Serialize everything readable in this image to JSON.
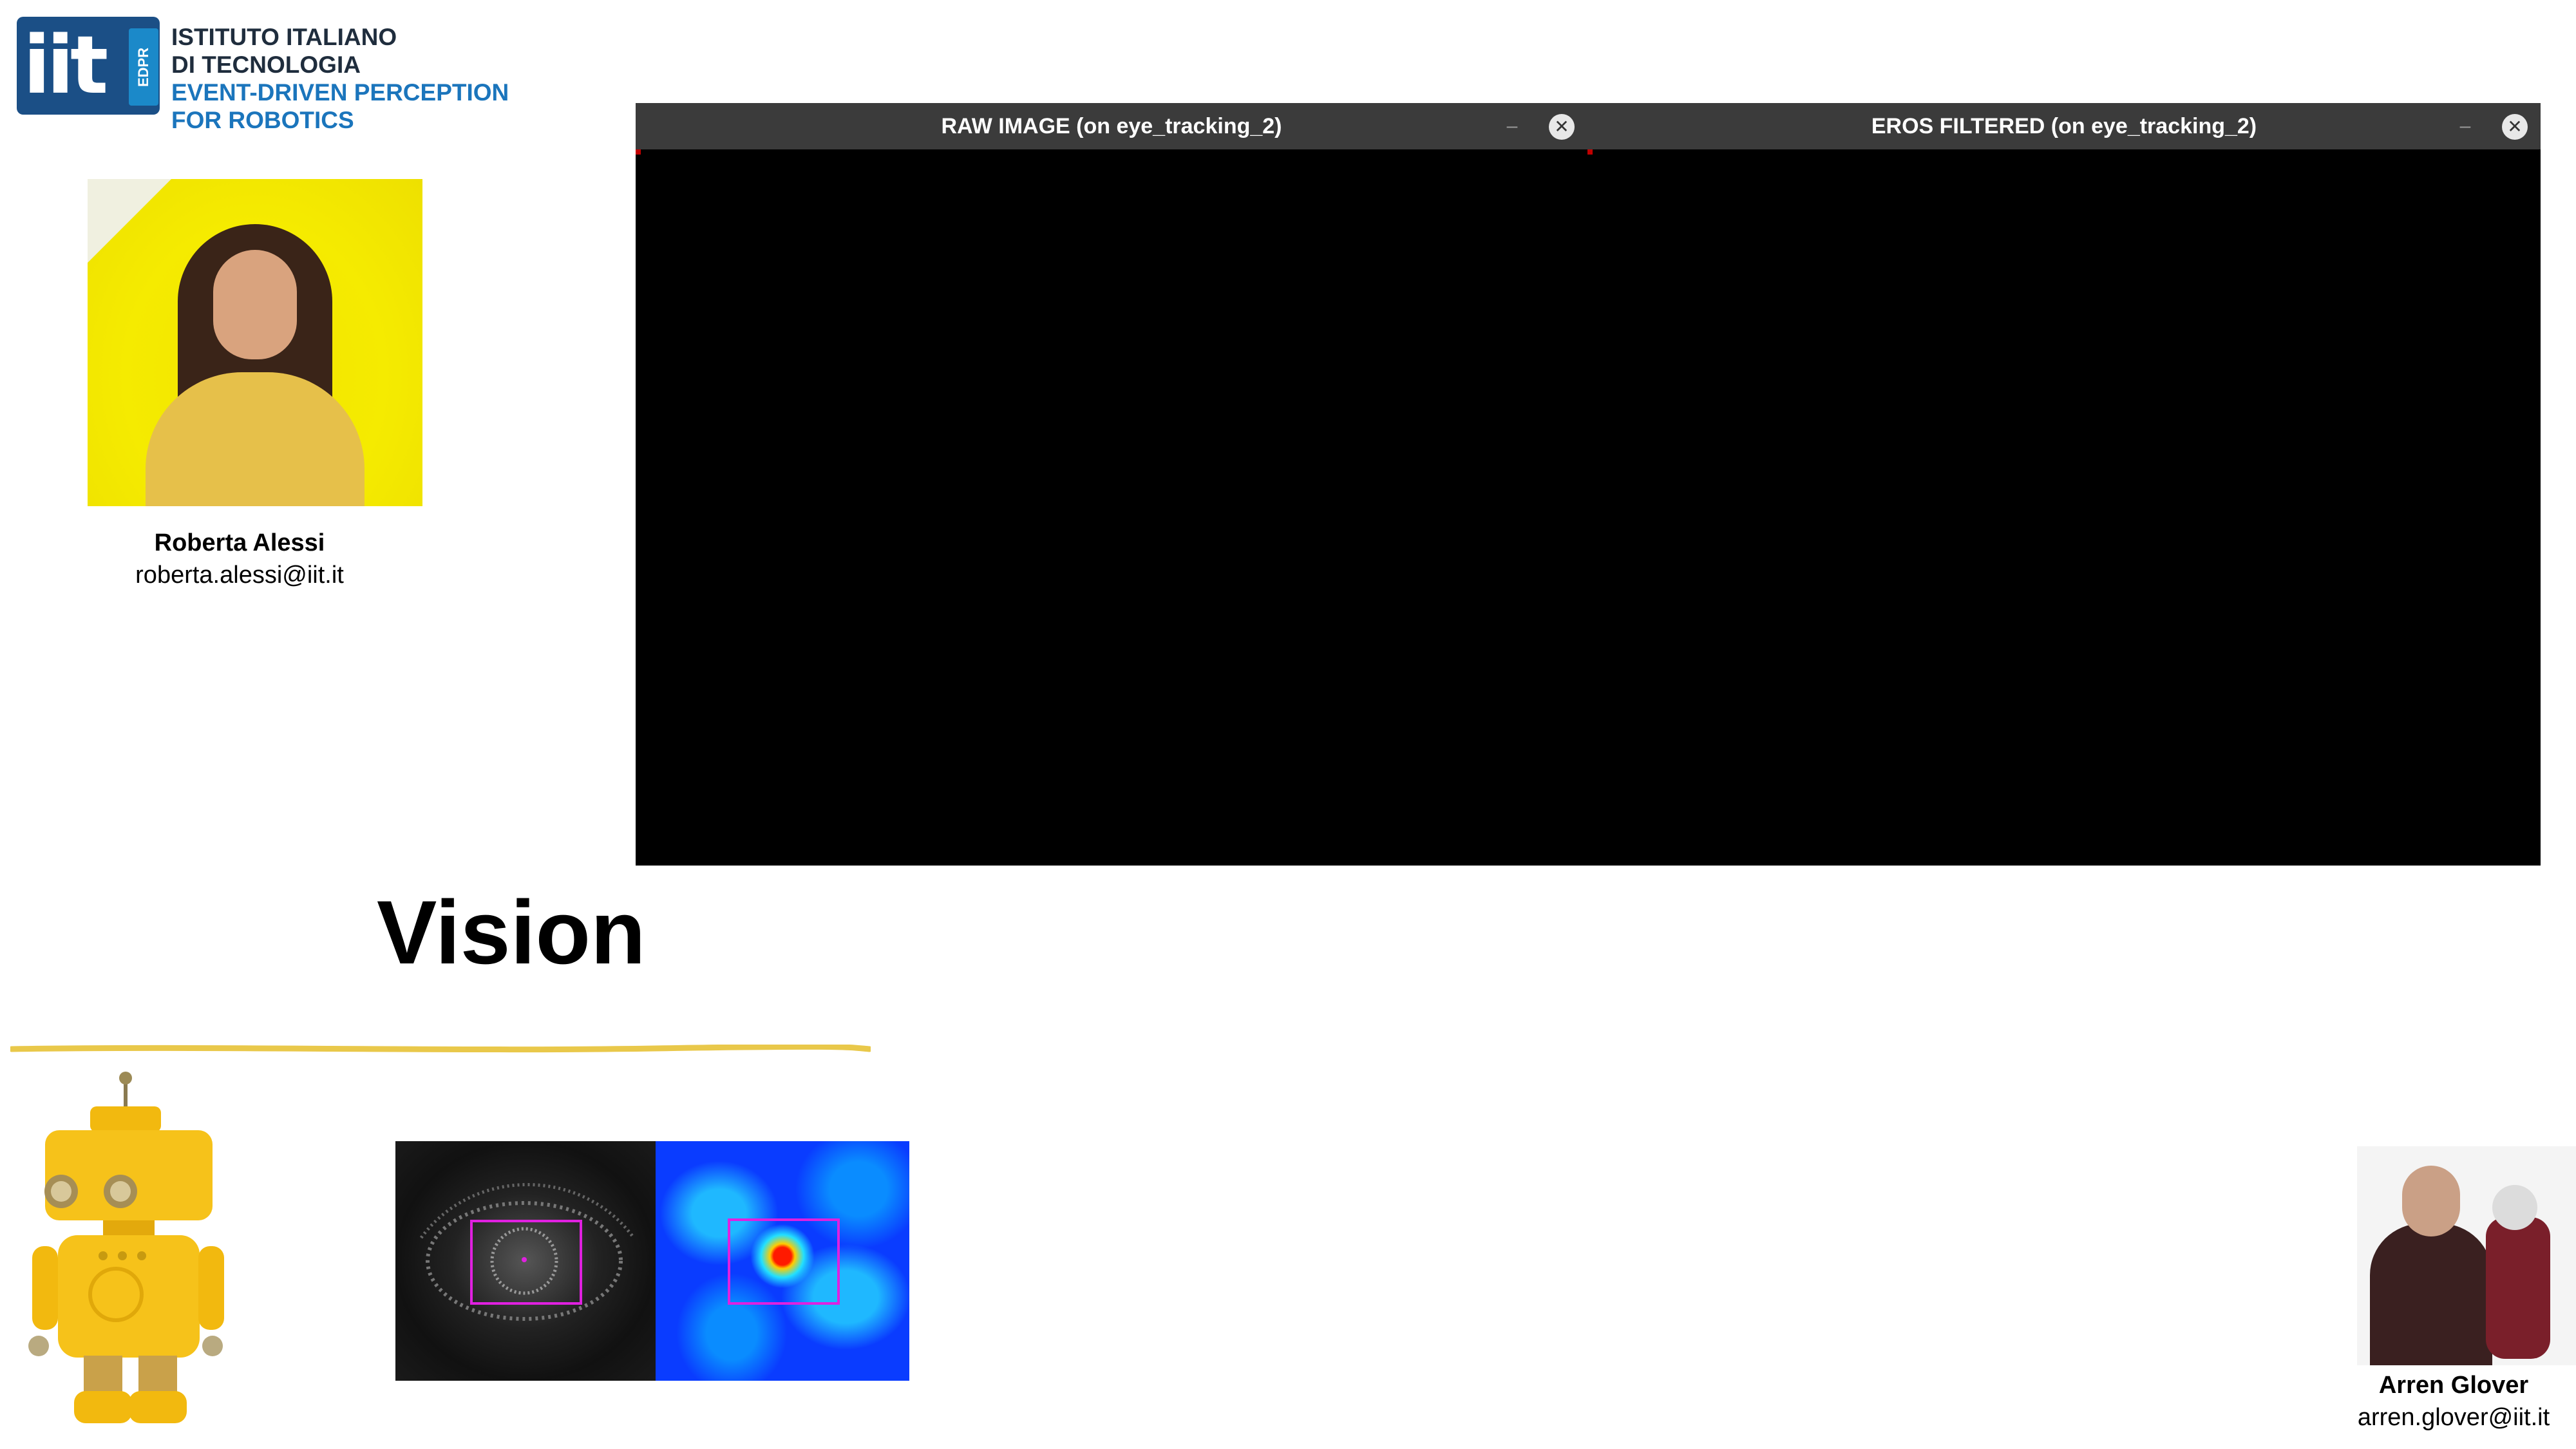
{
  "logo": {
    "mark_text": "iit",
    "tag_text": "EDPR",
    "lines": [
      "ISTITUTO ITALIANO",
      "DI TECNOLOGIA",
      "EVENT-DRIVEN PERCEPTION",
      "FOR ROBOTICS"
    ],
    "colors": {
      "dark": "#1f2d3d",
      "blue": "#1b75bc"
    }
  },
  "presenters": [
    {
      "name": "Roberta Alessi",
      "email": "roberta.alessi@iit.it"
    },
    {
      "name": "Arren Glover",
      "email": "arren.glover@iit.it"
    }
  ],
  "windows": [
    {
      "title": "RAW IMAGE (on eye_tracking_2)",
      "minimize": "–",
      "close": "✕"
    },
    {
      "title": "EROS FILTERED (on eye_tracking_2)",
      "minimize": "–",
      "close": "✕"
    }
  ],
  "slide": {
    "title": "Vision",
    "accent_color": "#e9c84a"
  }
}
